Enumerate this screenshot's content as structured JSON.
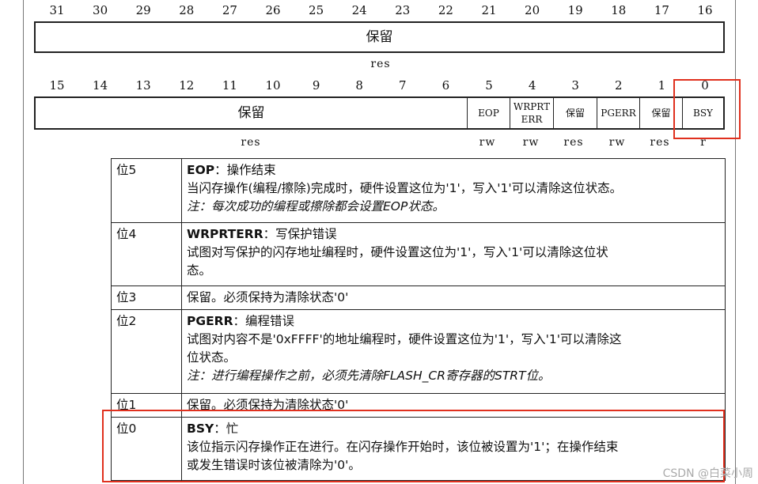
{
  "upper_bits": [
    "31",
    "30",
    "29",
    "28",
    "27",
    "26",
    "25",
    "24",
    "23",
    "22",
    "21",
    "20",
    "19",
    "18",
    "17",
    "16"
  ],
  "upper_field": "保留",
  "upper_access": "res",
  "lower_bits": [
    "15",
    "14",
    "13",
    "12",
    "11",
    "10",
    "9",
    "8",
    "7",
    "6",
    "5",
    "4",
    "3",
    "2",
    "1",
    "0"
  ],
  "lower_fields": {
    "reserved_main": "保留",
    "eop": "EOP",
    "wrprterr_line1": "WRPRT",
    "wrprterr_line2": "ERR",
    "res3": "保留",
    "pgerr": "PGERR",
    "res1": "保留",
    "bsy": "BSY"
  },
  "lower_access": {
    "reserved_main": "res",
    "bit5": "rw",
    "bit4": "rw",
    "bit3": "res",
    "bit2": "rw",
    "bit1": "res",
    "bit0": "r"
  },
  "rows": [
    {
      "bit": "位5",
      "name": "EOP",
      "title_rest": "：操作结束",
      "lines": [
        "当闪存操作(编程/擦除)完成时，硬件设置这位为'1'，写入'1'可以清除这位状态。"
      ],
      "note": "注：每次成功的编程或擦除都会设置EOP状态。"
    },
    {
      "bit": "位4",
      "name": "WRPRTERR",
      "title_rest": "：写保护错误",
      "lines": [
        "试图对写保护的闪存地址编程时，硬件设置这位为'1'，写入'1'可以清除这位状",
        "态。"
      ],
      "note": ""
    },
    {
      "bit": "位3",
      "name": "",
      "title_rest": "保留。必须保持为清除状态'0'",
      "lines": [],
      "note": ""
    },
    {
      "bit": "位2",
      "name": "PGERR",
      "title_rest": "：编程错误",
      "lines": [
        "试图对内容不是'0xFFFF'的地址编程时，硬件设置这位为'1'，写入'1'可以清除这",
        "位状态。"
      ],
      "note": "注：进行编程操作之前，必须先清除FLASH_CR寄存器的STRT位。"
    },
    {
      "bit": "位1",
      "name": "",
      "title_rest": "保留。必须保持为清除状态'0'",
      "lines": [],
      "note": ""
    },
    {
      "bit": "位0",
      "name": "BSY",
      "title_rest": "：忙",
      "lines": [
        "该位指示闪存操作正在进行。在闪存操作开始时，该位被设置为'1'；在操作结束",
        "或发生错误时该位被清除为'0'。"
      ],
      "note": ""
    }
  ],
  "watermark": "CSDN @白菜小周",
  "highlight_color": "#e0301e"
}
